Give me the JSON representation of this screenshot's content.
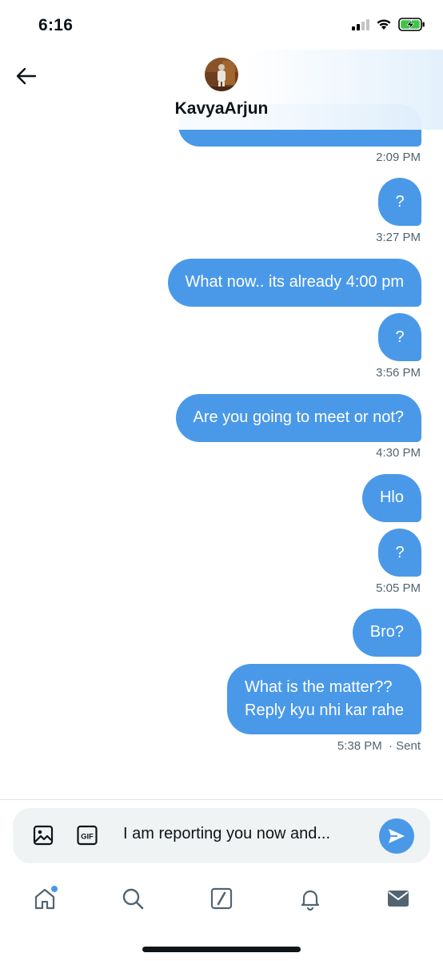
{
  "status_bar": {
    "time": "6:16"
  },
  "header": {
    "contact_name": "KavyaArjun"
  },
  "messages": [
    {
      "text": "",
      "timestamp": "2:09 PM"
    },
    {
      "text": "?",
      "timestamp": "3:27 PM"
    },
    {
      "text": "What now.. its already 4:00 pm",
      "timestamp": ""
    },
    {
      "text": "?",
      "timestamp": "3:56 PM"
    },
    {
      "text": "Are you going to meet or not?",
      "timestamp": "4:30 PM"
    },
    {
      "text": "Hlo",
      "timestamp": ""
    },
    {
      "text": "?",
      "timestamp": "5:05 PM"
    },
    {
      "text": "Bro?",
      "timestamp": ""
    },
    {
      "text_line1": "What is the matter??",
      "text_line2": "Reply kyu nhi kar rahe",
      "timestamp": "5:38 PM",
      "status": "· Sent"
    }
  ],
  "composer": {
    "draft_text": "I am reporting you now and..."
  },
  "colors": {
    "bubble": "#4a99e9",
    "timestamp": "#536471",
    "composer_bg": "#eff3f4"
  },
  "icons": {
    "back": "arrow-left-icon",
    "image": "image-icon",
    "gif": "gif-icon",
    "send": "send-icon",
    "home": "home-icon",
    "search": "search-icon",
    "grok": "slash-square-icon",
    "notifications": "bell-icon",
    "messages": "envelope-icon"
  },
  "gif_label": "GIF"
}
